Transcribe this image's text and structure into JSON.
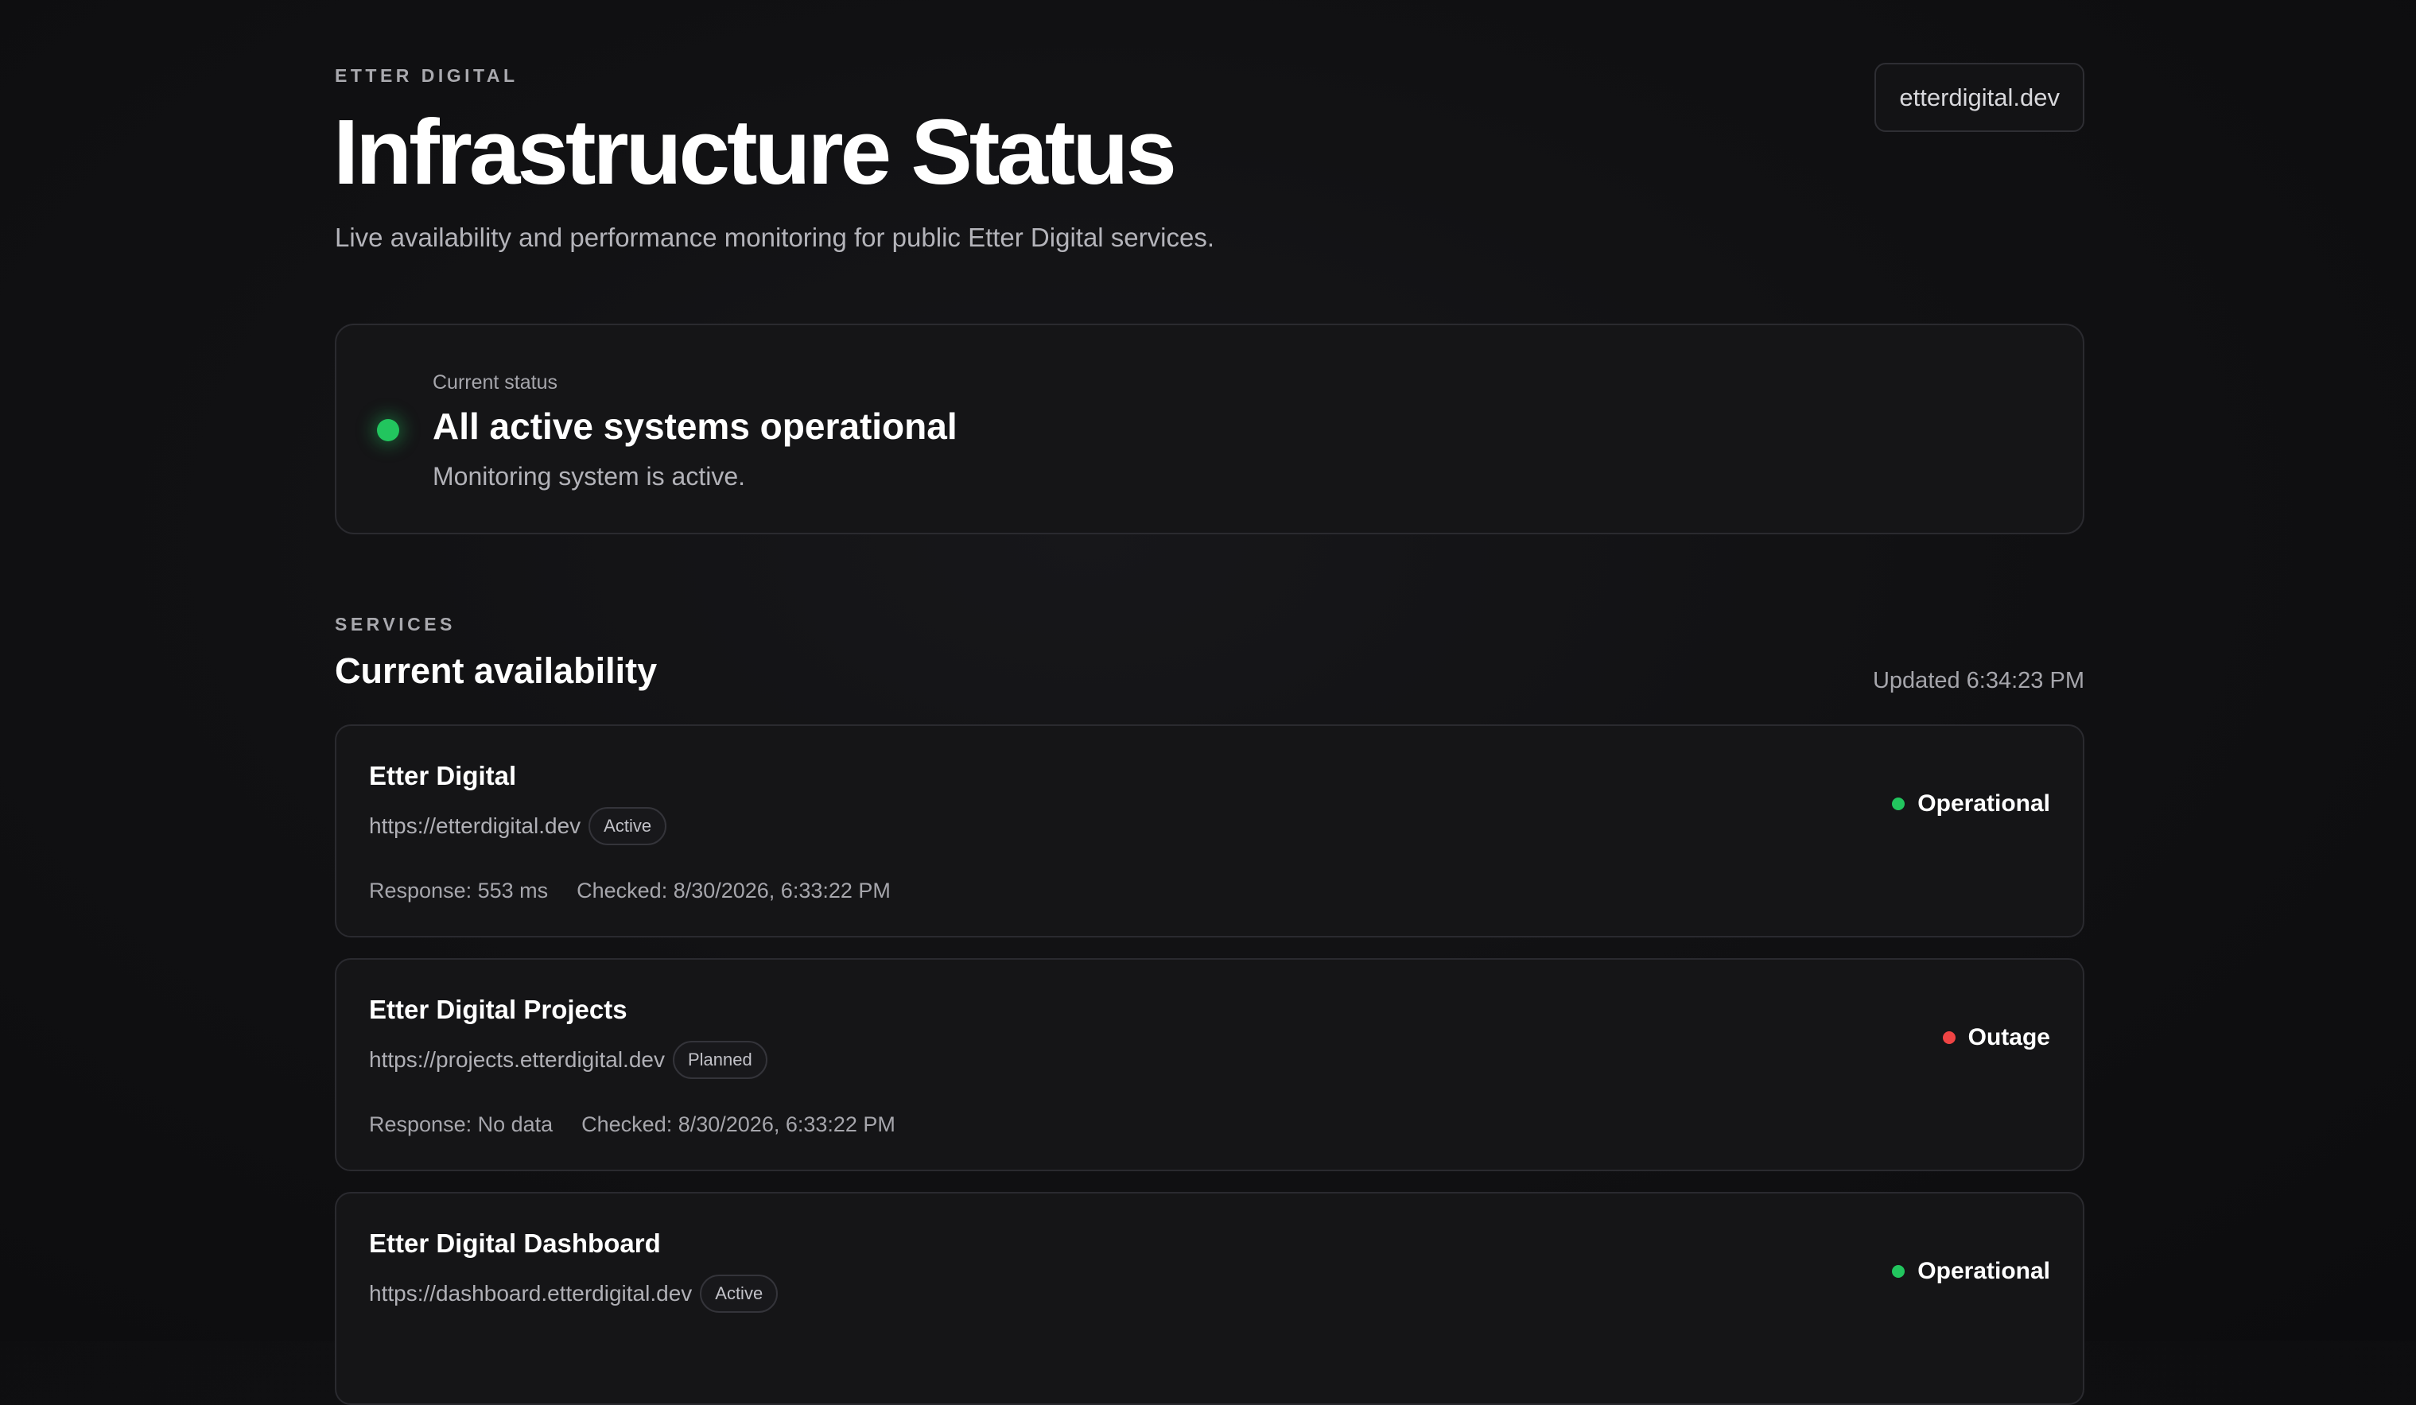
{
  "header": {
    "brand": "ETTER DIGITAL",
    "title": "Infrastructure Status",
    "subtitle": "Live availability and performance monitoring for public Etter Digital services.",
    "site_link": "etterdigital.dev"
  },
  "current_status": {
    "label": "Current status",
    "headline": "All active systems operational",
    "note": "Monitoring system is active.",
    "color": "#22c55e"
  },
  "services_section": {
    "eyebrow": "SERVICES",
    "title": "Current availability",
    "updated": "Updated 6:34:23 PM"
  },
  "services": [
    {
      "name": "Etter Digital",
      "url": "https://etterdigital.dev",
      "tag": "Active",
      "response": "Response: 553 ms",
      "checked": "Checked: 8/30/2026, 6:33:22 PM",
      "status": "Operational",
      "status_color": "#22c55e"
    },
    {
      "name": "Etter Digital Projects",
      "url": "https://projects.etterdigital.dev",
      "tag": "Planned",
      "response": "Response: No data",
      "checked": "Checked: 8/30/2026, 6:33:22 PM",
      "status": "Outage",
      "status_color": "#ef4444"
    },
    {
      "name": "Etter Digital Dashboard",
      "url": "https://dashboard.etterdigital.dev",
      "tag": "Active",
      "status": "Operational",
      "status_color": "#22c55e"
    }
  ]
}
